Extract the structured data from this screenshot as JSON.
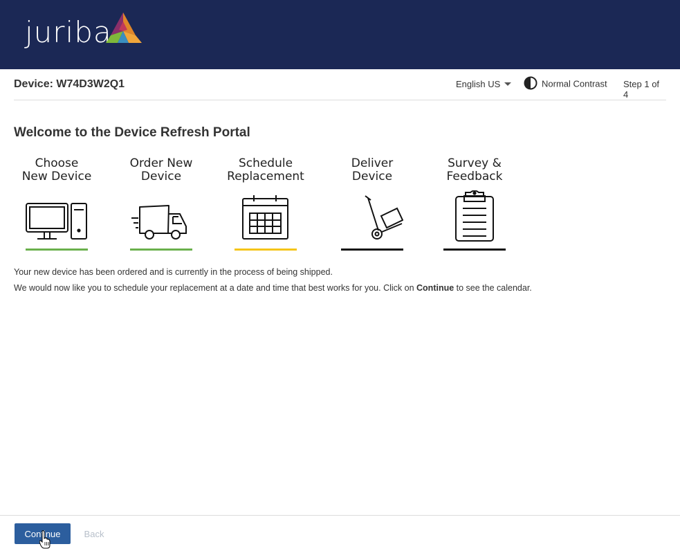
{
  "header": {
    "logo_text": "juriba",
    "colors": {
      "background": "#1b2855"
    }
  },
  "topbar": {
    "device_title": "Device: W74D3W2Q1",
    "language": "English US",
    "contrast": "Normal Contrast",
    "step_indicator": "Step 1 of 4"
  },
  "main": {
    "title": "Welcome to the Device Refresh Portal",
    "steps": [
      {
        "label": "Choose\nNew Device",
        "icon": "computer-icon",
        "status_color": "#6ab04c"
      },
      {
        "label": "Order New\nDevice",
        "icon": "truck-icon",
        "status_color": "#6ab04c"
      },
      {
        "label": "Schedule\nReplacement",
        "icon": "calendar-icon",
        "status_color": "#f5c518"
      },
      {
        "label": "Deliver\nDevice",
        "icon": "hand-truck-icon",
        "status_color": "#111111"
      },
      {
        "label": "Survey &\nFeedback",
        "icon": "clipboard-icon",
        "status_color": "#111111"
      }
    ],
    "info_line1": "Your new device has been ordered and is currently in the process of being shipped.",
    "info_line2_before": "We would now like you to schedule your replacement at a date and time that best works for you. Click on ",
    "info_line2_bold": "Continue",
    "info_line2_after": " to see the calendar."
  },
  "footer": {
    "continue_label": "Continue",
    "back_label": "Back",
    "colors": {
      "primary": "#2c5e9e",
      "disabled": "#b7bfca"
    }
  }
}
